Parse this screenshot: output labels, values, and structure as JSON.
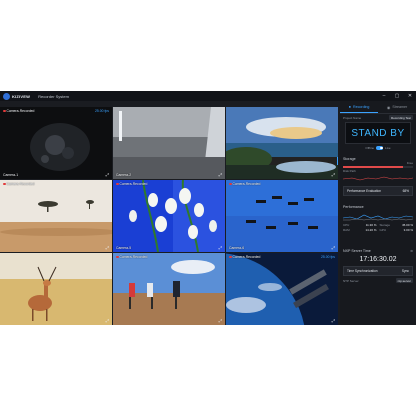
{
  "app": {
    "logo_text": "KIZIVEW",
    "title": "Recorder System",
    "window_controls": [
      "–",
      "▢",
      "✕"
    ]
  },
  "cameras": [
    {
      "name": "Camera-Recorded",
      "fps": "25.00 fps",
      "label": "Camera-1",
      "recording": true
    },
    {
      "name": "",
      "fps": "",
      "label": "Camera-2",
      "recording": false
    },
    {
      "name": "",
      "fps": "",
      "label": "",
      "recording": false
    },
    {
      "name": "Camera-Recorded",
      "fps": "",
      "label": "",
      "recording": true
    },
    {
      "name": "Camera-Recorded",
      "fps": "",
      "label": "Camera-5",
      "recording": true
    },
    {
      "name": "Camera-Recorded",
      "fps": "",
      "label": "Camera-6",
      "recording": true
    },
    {
      "name": "",
      "fps": "",
      "label": "",
      "recording": false
    },
    {
      "name": "Camera-Recorded",
      "fps": "",
      "label": "",
      "recording": true
    },
    {
      "name": "Camera-Recorded",
      "fps": "25.00 fps",
      "label": "",
      "recording": true
    }
  ],
  "panel": {
    "tabs": [
      {
        "label": "Recording",
        "icon": "record-icon",
        "active": true
      },
      {
        "label": "Streamer",
        "icon": "stream-icon",
        "active": false
      }
    ],
    "project": {
      "label": "Project Name",
      "value": "Recording Test"
    },
    "status": "STAND BY",
    "mode": {
      "off": "Offline",
      "on": "Live"
    },
    "storage": {
      "title": "Storage",
      "free": "Free",
      "percent": 0.85,
      "path_label": "Disk Path",
      "eval_label": "Performance Evaluation",
      "eval_value": "68%"
    },
    "performance": {
      "title": "Performance",
      "rows": [
        {
          "k": "CPU",
          "v": "11.30 %"
        },
        {
          "k": "Storage",
          "v": "45.00 %"
        },
        {
          "k": "RAM",
          "v": "14.20 %"
        },
        {
          "k": "GPU",
          "v": "3.00 %"
        }
      ]
    },
    "timer": {
      "title": "NXP Server Time",
      "time": "17:16:30.02",
      "date": "",
      "sync_label": "Time Synchronization",
      "sync_value": "Sync",
      "server_label": "NTP Server",
      "server_value": "ntp.server"
    }
  }
}
